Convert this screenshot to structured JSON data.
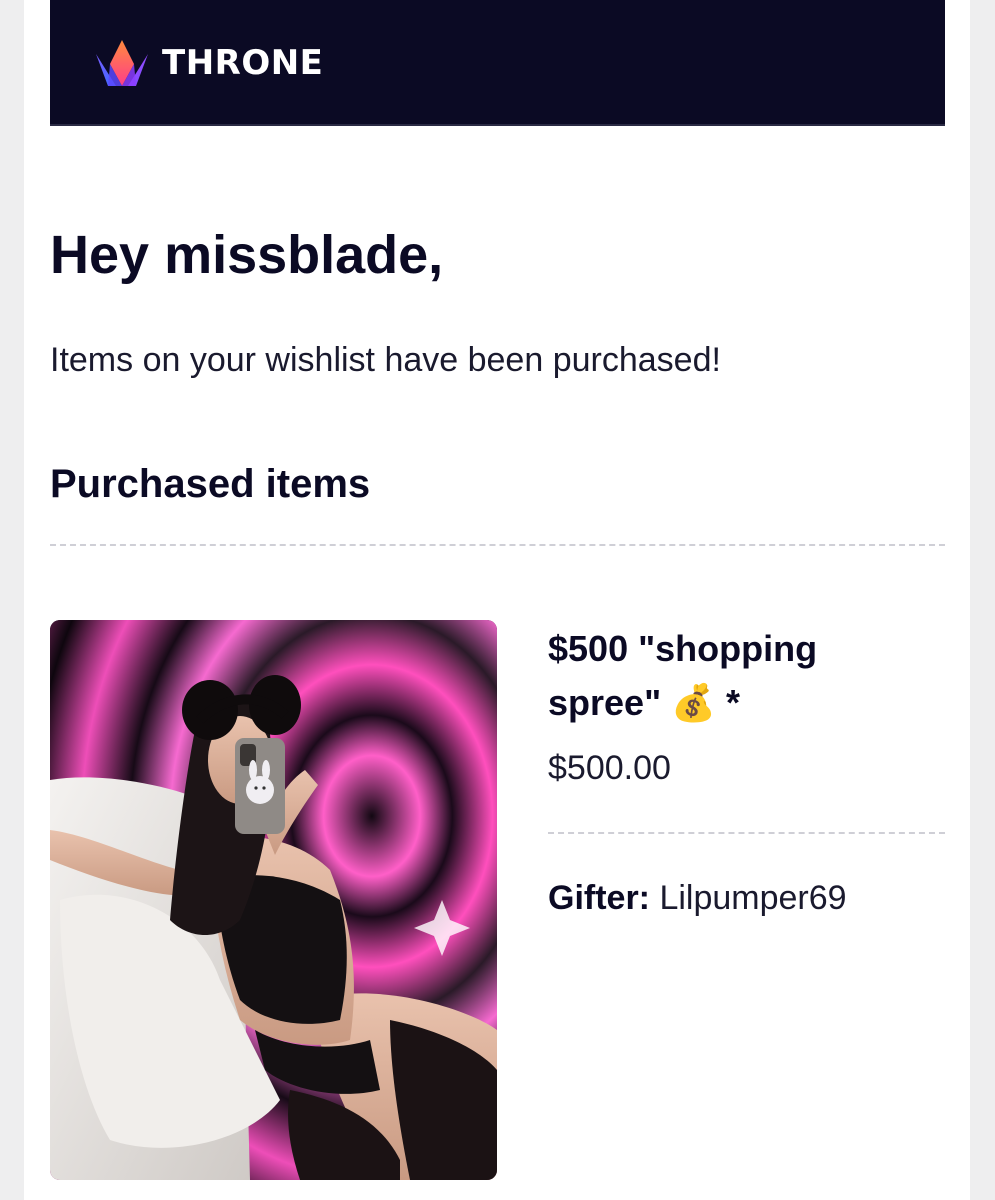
{
  "header": {
    "brand": "THRONE",
    "logo_icon": "crown-icon",
    "background": "#0b0a24"
  },
  "email": {
    "greeting": "Hey missblade,",
    "message": "Items on your wishlist have been purchased!",
    "section_title": "Purchased items"
  },
  "item": {
    "name": "$500 \"shopping spree\" 💰 *",
    "price": "$500.00",
    "gifter_label": "Gifter:",
    "gifter_name": "Lilpumper69",
    "image_icon": "product-photo"
  },
  "colors": {
    "text_dark": "#0b0a24",
    "accent_pink": "#e64fb4",
    "page_bg": "#eeeeef"
  }
}
